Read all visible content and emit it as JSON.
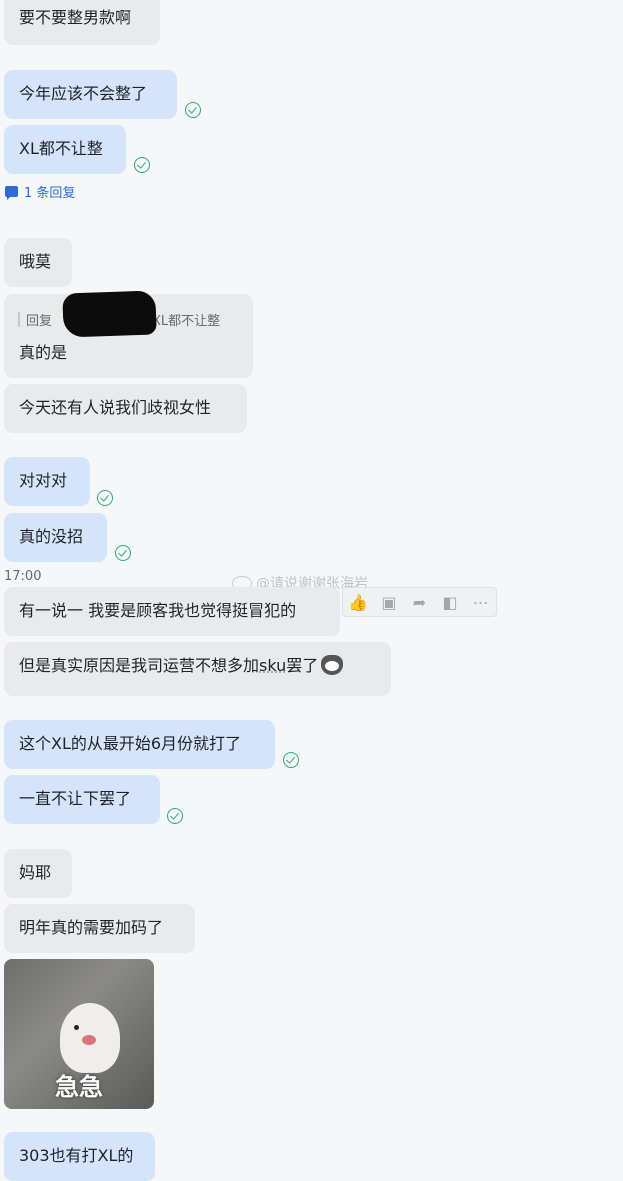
{
  "messages": {
    "m1": "要不要整男款啊",
    "m2": "今年应该不会整了",
    "m3": "XL都不让整",
    "reply_count": "1 条回复",
    "m4": "哦莫",
    "quote_prefix": "回复",
    "quote_text": "XL都不让整",
    "m5": "真的是",
    "m6": "今天还有人说我们歧视女性",
    "m7": "对对对",
    "m8": "真的没招",
    "timestamp": "17:00",
    "m9": "有一说一 我要是顾客我也觉得挺冒犯的",
    "m10_a": "但是真实原因是我司运营不想多加",
    "m10_b": "sku",
    "m10_c": "罢了",
    "m11": "这个XL的从最开始6月份就打了",
    "m12": "一直不让下罢了",
    "m13": "妈耶",
    "m14": "明年真的需要加码了",
    "sticker_text": "急急",
    "m15": "303也有打XL的"
  },
  "watermark": "@请说谢谢张海岩",
  "colors": {
    "other_bubble": "#e9eaec",
    "mine_bubble": "#d5e4fb",
    "check": "#2ea87e",
    "link": "#2f6bd8"
  }
}
